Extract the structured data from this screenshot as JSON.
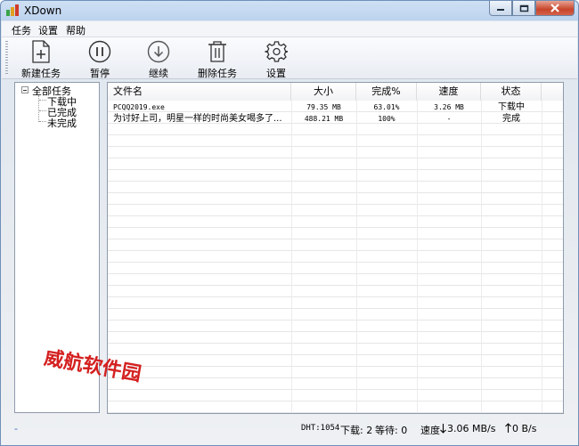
{
  "window": {
    "title": "XDown"
  },
  "menu": [
    "任务",
    "设置",
    "帮助"
  ],
  "toolbar": {
    "new_task": "新建任务",
    "pause": "暂停",
    "resume": "继续",
    "delete_task": "删除任务",
    "settings": "设置"
  },
  "tree": {
    "root": "全部任务",
    "children": [
      "下载中",
      "已完成",
      "未完成"
    ]
  },
  "table": {
    "columns": [
      "文件名",
      "大小",
      "完成%",
      "速度",
      "状态"
    ],
    "rows": [
      {
        "name": "PCQQ2019.exe",
        "size": "79.35 MB",
        "percent": "63.01%",
        "speed": "3.26 MB",
        "status": "下载中"
      },
      {
        "name": "为讨好上司，明星一样的时尚美女喝多了...",
        "size": "488.21 MB",
        "percent": "100%",
        "speed": "-",
        "status": "完成"
      }
    ]
  },
  "watermark": "威航软件园",
  "status": {
    "left_marker": "-",
    "dht": "DHT:1054",
    "downloading": "下载: 2",
    "waiting": "等待: 0",
    "down_speed_label": "速度",
    "down_speed": "3.06 MB/s",
    "up_speed": "0 B/s"
  },
  "icons": {
    "app": "app-icon",
    "new_task": "new-task-icon",
    "pause": "pause-icon",
    "resume": "resume-icon",
    "delete": "trash-icon",
    "settings": "gear-icon",
    "down_arrow": "arrow-down-icon",
    "up_arrow": "arrow-up-icon"
  },
  "colors": {
    "watermark": "#d42020",
    "close_button": "#c7452a",
    "titlebar": "#bcd3ee"
  }
}
